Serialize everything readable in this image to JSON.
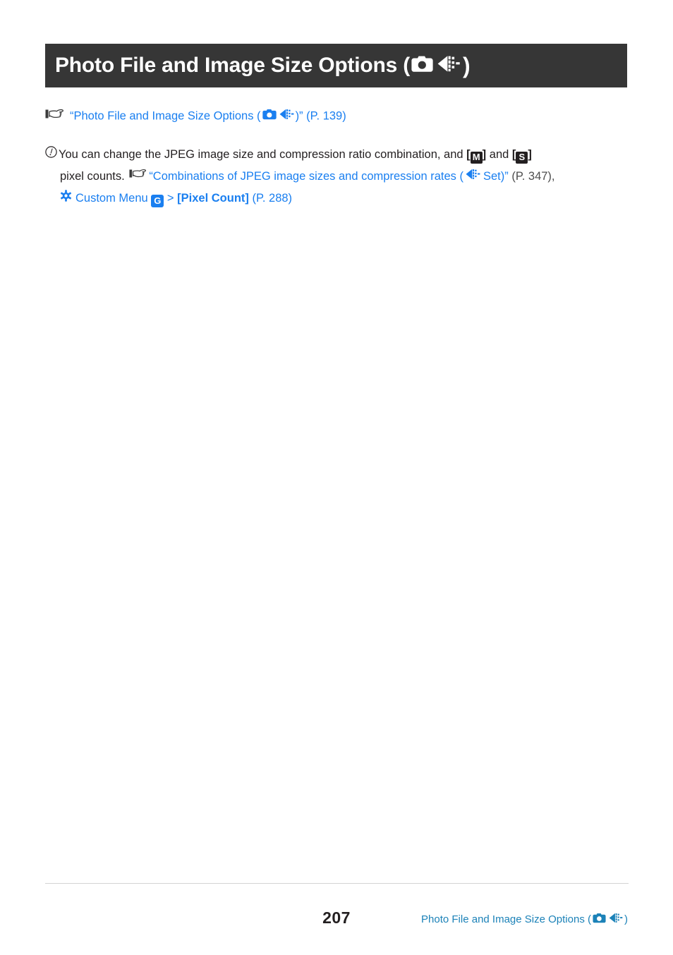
{
  "document": {
    "page_number": "207",
    "background_color": "#ffffff"
  },
  "title_bar": {
    "background_color": "#363636",
    "text_color": "#ffffff",
    "text_before_icons": "Photo File and Image Size Options (",
    "text_after_icons": ")",
    "icons": [
      "camera-icon",
      "image-quality-icon"
    ]
  },
  "reference_line": {
    "pointer_icon": "pointing-hand-icon",
    "open_quote": "“Photo File and Image Size Options (",
    "icons": [
      "camera-icon",
      "image-quality-icon"
    ],
    "close_quote": ")”",
    "page_ref": "(P. 139)",
    "link_color": "#1a7ff0"
  },
  "note": {
    "info_icon": "circled-exclamation-icon",
    "line1": {
      "text_a": "You can change the JPEG image size and compression ratio combination, and",
      "badge_m": "M",
      "between": "and",
      "badge_s": "S",
      "bracket_open": "[",
      "bracket_close": "]"
    },
    "line2": {
      "text_a": "pixel counts.",
      "pointer_icon": "pointing-hand-icon",
      "link_a": "“Combinations of JPEG image sizes and compression rates (",
      "quality_icon": "image-quality-icon",
      "link_b": "Set)”",
      "page_ref": "(P. 347),"
    },
    "line3": {
      "gear_icon": "gear-icon",
      "menu_label": "Custom Menu",
      "menu_badge": "G",
      "separator": ">",
      "setting_label": "[Pixel Count]",
      "page_ref": "(P. 288)"
    },
    "text_color": "#231f20",
    "link_color": "#1a7ff0"
  },
  "footer": {
    "divider_color": "#d4d4d4",
    "page_number": "207",
    "title_before_icons": "Photo File and Image Size Options (",
    "title_after_icons": ")",
    "icons": [
      "camera-icon",
      "image-quality-icon"
    ],
    "color": "#1c82b8"
  }
}
